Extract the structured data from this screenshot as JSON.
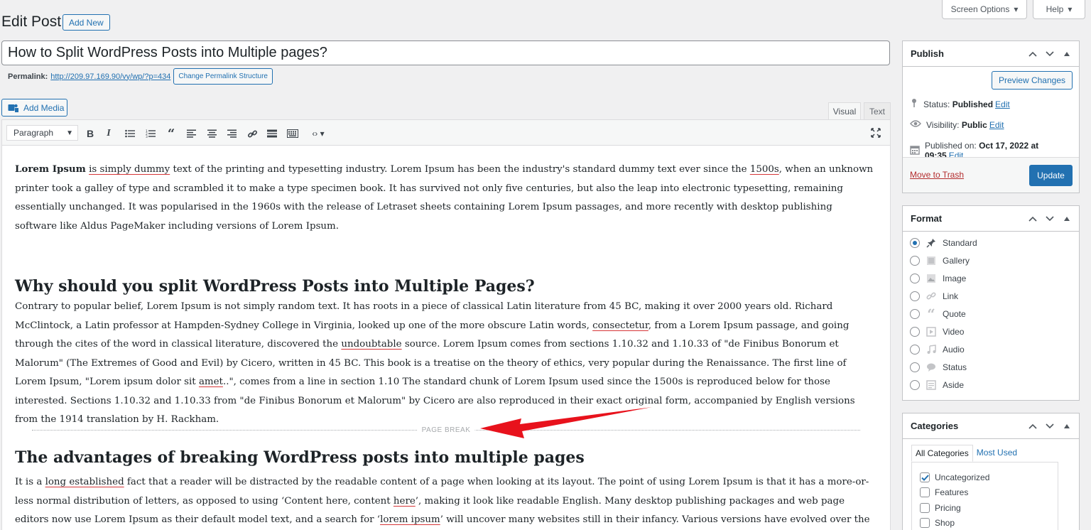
{
  "header": {
    "screen_options": "Screen Options",
    "help": "Help",
    "page_title": "Edit Post",
    "add_new": "Add New"
  },
  "post": {
    "title": "How to Split WordPress Posts into Multiple pages?",
    "permalink_label": "Permalink:",
    "permalink_url": "http://209.97.169.90/vy/wp/?p=434",
    "change_permalink": "Change Permalink Structure"
  },
  "editor": {
    "add_media": "Add Media",
    "tab_visual": "Visual",
    "tab_text": "Text",
    "format_select": "Paragraph",
    "toolbar_icons": [
      "bold-icon",
      "italic-icon",
      "bullet-list-icon",
      "numbered-list-icon",
      "blockquote-icon",
      "align-left-icon",
      "align-center-icon",
      "align-right-icon",
      "link-icon",
      "read-more-icon",
      "toolbar-toggle-icon",
      "code-icon",
      "fullscreen-icon"
    ],
    "page_break_label": "PAGE BREAK",
    "paragraph1": {
      "bold_lead": "Lorem Ipsum",
      "s1": "is simply dummy",
      "t1": " text of the printing and typesetting industry. Lorem Ipsum has been the industry's standard dummy text ever since the ",
      "s2": "1500s",
      "t2": ", when an unknown printer took a galley of type and scrambled it to make a type specimen book. It has survived not only five centuries, but also the leap into electronic typesetting, remaining essentially unchanged. It was popularised in the 1960s with the release of Letraset sheets containing Lorem Ipsum passages, and more recently with desktop publishing software like Aldus PageMaker including versions of Lorem Ipsum."
    },
    "heading1": "Why should you split WordPress Posts into Multiple Pages?",
    "paragraph2": {
      "t1": "Contrary to popular belief, Lorem Ipsum is not simply random text. It has roots in a piece of classical Latin literature from 45 BC, making it over 2000 years old. Richard McClintock, a Latin professor at Hampden-Sydney College in Virginia, looked up one of the more obscure Latin words, ",
      "s1": "consectetur",
      "t2": ", from a Lorem Ipsum passage, and going through the cites of the word in classical literature, discovered the ",
      "s2": "undoubtable",
      "t3": " source. Lorem Ipsum comes from sections 1.10.32 and 1.10.33 of \"de Finibus Bonorum et Malorum\" (The Extremes of Good and Evil) by Cicero, written in 45 BC. This book is a treatise on the theory of ethics, very popular during the Renaissance. The first line of Lorem Ipsum, \"Lorem ipsum dolor sit ",
      "s3": "amet",
      "t4": "..\", comes from a line in section 1.10 The standard chunk of Lorem Ipsum used since the 1500s is reproduced below for those interested. Sections 1.10.32 and 1.10.33 from \"de Finibus Bonorum et Malorum\" by Cicero are also reproduced in their exact original form, accompanied by English versions from the 1914 translation by H. Rackham."
    },
    "heading2": "The advantages of breaking WordPress posts into multiple pages",
    "paragraph3": {
      "t1": "It is a ",
      "s1": "long established",
      "t2": " fact that a reader will be distracted by the readable content of a page when looking at its layout. The point of using Lorem Ipsum is that it has a more-or-less normal distribution of letters, as opposed to using ‘Content here, content ",
      "s2": "here",
      "t3": "’, making it look like readable English. Many desktop publishing packages and web page editors now use Lorem Ipsum as their default model text, and a search for ‘",
      "s3": "lorem ipsum",
      "t4": "’ will uncover many websites still in their infancy. Various versions have evolved over the years, sometimes by accident, sometimes on"
    }
  },
  "publish": {
    "title": "Publish",
    "preview": "Preview Changes",
    "status_label": "Status:",
    "status_value": "Published",
    "visibility_label": "Visibility:",
    "visibility_value": "Public",
    "published_label": "Published on:",
    "published_value": "Oct 17, 2022 at 09:35",
    "edit": "Edit",
    "trash": "Move to Trash",
    "update": "Update"
  },
  "format": {
    "title": "Format",
    "options": [
      {
        "label": "Standard",
        "icon": "pin-icon",
        "checked": true
      },
      {
        "label": "Gallery",
        "icon": "gallery-icon",
        "checked": false
      },
      {
        "label": "Image",
        "icon": "image-icon",
        "checked": false
      },
      {
        "label": "Link",
        "icon": "link-icon",
        "checked": false
      },
      {
        "label": "Quote",
        "icon": "quote-icon",
        "checked": false
      },
      {
        "label": "Video",
        "icon": "video-icon",
        "checked": false
      },
      {
        "label": "Audio",
        "icon": "audio-icon",
        "checked": false
      },
      {
        "label": "Status",
        "icon": "status-icon",
        "checked": false
      },
      {
        "label": "Aside",
        "icon": "aside-icon",
        "checked": false
      }
    ]
  },
  "categories": {
    "title": "Categories",
    "tab_all": "All Categories",
    "tab_most": "Most Used",
    "items": [
      {
        "label": "Uncategorized",
        "checked": true
      },
      {
        "label": "Features",
        "checked": false
      },
      {
        "label": "Pricing",
        "checked": false
      },
      {
        "label": "Shop",
        "checked": false
      }
    ]
  },
  "colors": {
    "accent": "#2271b1",
    "annotation_arrow": "#e8121c",
    "trash": "#b32d2e"
  }
}
